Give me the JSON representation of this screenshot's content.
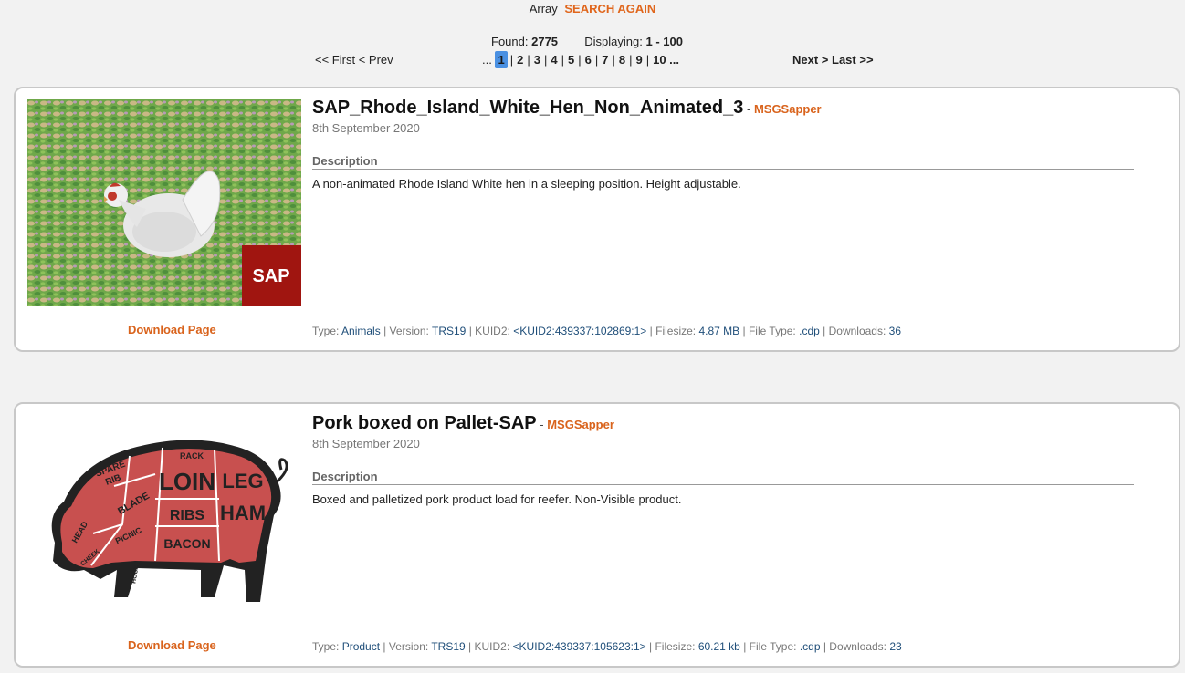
{
  "header": {
    "array_label": "Array",
    "search_again": "SEARCH AGAIN",
    "found_label": "Found:",
    "found_count": "2775",
    "displaying_label": "Displaying:",
    "displaying_range": "1 - 100"
  },
  "pagination": {
    "first": "<< First",
    "prev": "< Prev",
    "ellipsis_before": "...",
    "pages": [
      "1",
      "2",
      "3",
      "4",
      "5",
      "6",
      "7",
      "8",
      "9",
      "10 ..."
    ],
    "current": "1",
    "next": "Next >",
    "last": "Last >>"
  },
  "items": [
    {
      "title": "SAP_Rhode_Island_White_Hen_Non_Animated_3",
      "author_sep": "-",
      "author": "MSGSapper",
      "date": "8th September 2020",
      "description_heading": "Description",
      "description": "A non-animated Rhode Island White hen in a sleeping position. Height adjustable.",
      "download_label": "Download Page",
      "badge": "SAP",
      "type_label": "Type:",
      "type": "Animals",
      "version_label": "| Version:",
      "version": "TRS19",
      "kuid_label": "| KUID2:",
      "kuid": "<KUID2:439337:102869:1>",
      "filesize_label": "| Filesize:",
      "filesize": "4.87 MB",
      "filetype_label": "| File Type:",
      "filetype": ".cdp",
      "downloads_label": "| Downloads:",
      "downloads": "36"
    },
    {
      "title": "Pork boxed on Pallet-SAP",
      "author_sep": "-",
      "author": "MSGSapper",
      "date": "8th September 2020",
      "description_heading": "Description",
      "description": "Boxed and palletized pork product load for reefer. Non-Visible product.",
      "download_label": "Download Page",
      "cuts": [
        "RACK",
        "SPARE",
        "RIB",
        "BLADE",
        "LOIN",
        "LEG",
        "HAM",
        "PICNIC",
        "RIBS",
        "BACON",
        "HEAD",
        "CHEEK",
        "HOCK"
      ],
      "type_label": "Type:",
      "type": "Product",
      "version_label": "| Version:",
      "version": "TRS19",
      "kuid_label": "| KUID2:",
      "kuid": "<KUID2:439337:105623:1>",
      "filesize_label": "| Filesize:",
      "filesize": "60.21 kb",
      "filetype_label": "| File Type:",
      "filetype": ".cdp",
      "downloads_label": "| Downloads:",
      "downloads": "23"
    }
  ],
  "colors": {
    "accent_orange": "#d9631c",
    "link_blue": "#1f4e79",
    "active_page": "#4a90e2",
    "pork_red": "#c8504f"
  }
}
